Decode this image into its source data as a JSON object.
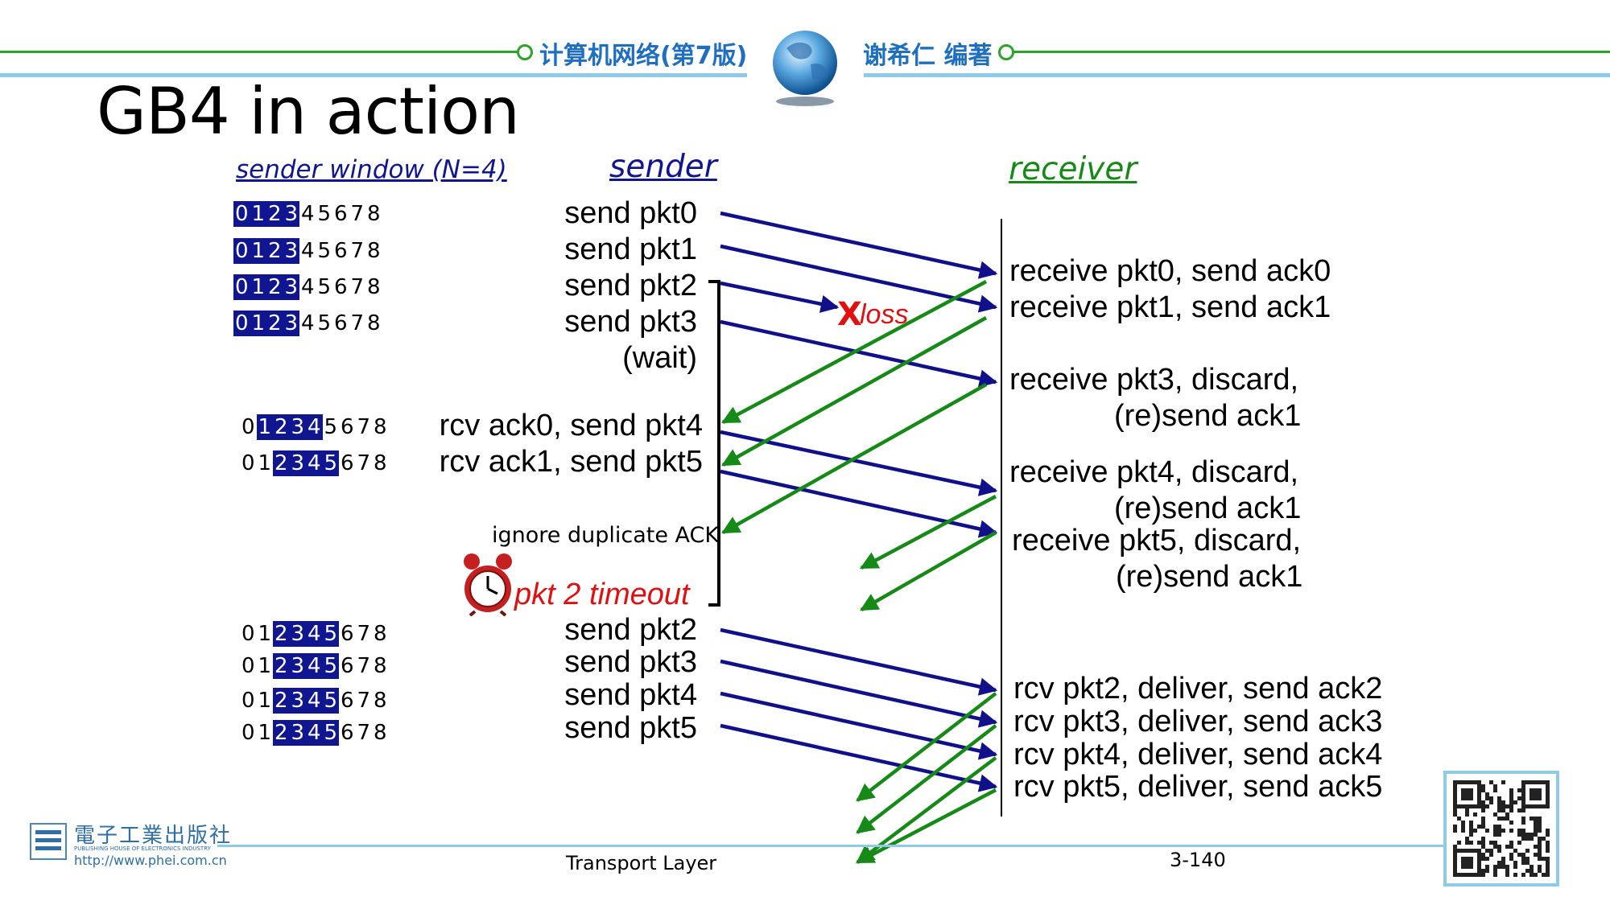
{
  "header": {
    "book_title": "计算机网络(第7版)",
    "author": "谢希仁 编著"
  },
  "slide": {
    "title": "GB4 in action"
  },
  "labels": {
    "sender_window": "sender window (N=4)",
    "sender": "sender",
    "receiver": "receiver",
    "loss_mark": "X",
    "loss": "loss",
    "ignore_dup": "ignore duplicate ACK",
    "timeout": "pkt 2 timeout"
  },
  "windows": [
    {
      "seq": [
        "0",
        "1",
        "2",
        "3",
        "4",
        "5",
        "6",
        "7",
        "8"
      ],
      "start": 0
    },
    {
      "seq": [
        "0",
        "1",
        "2",
        "3",
        "4",
        "5",
        "6",
        "7",
        "8"
      ],
      "start": 0
    },
    {
      "seq": [
        "0",
        "1",
        "2",
        "3",
        "4",
        "5",
        "6",
        "7",
        "8"
      ],
      "start": 0
    },
    {
      "seq": [
        "0",
        "1",
        "2",
        "3",
        "4",
        "5",
        "6",
        "7",
        "8"
      ],
      "start": 0
    },
    {
      "seq": [
        "0",
        "1",
        "2",
        "3",
        "4",
        "5",
        "6",
        "7",
        "8"
      ],
      "start": 1
    },
    {
      "seq": [
        "0",
        "1",
        "2",
        "3",
        "4",
        "5",
        "6",
        "7",
        "8"
      ],
      "start": 2
    },
    {
      "seq": [
        "0",
        "1",
        "2",
        "3",
        "4",
        "5",
        "6",
        "7",
        "8"
      ],
      "start": 2
    },
    {
      "seq": [
        "0",
        "1",
        "2",
        "3",
        "4",
        "5",
        "6",
        "7",
        "8"
      ],
      "start": 2
    },
    {
      "seq": [
        "0",
        "1",
        "2",
        "3",
        "4",
        "5",
        "6",
        "7",
        "8"
      ],
      "start": 2
    },
    {
      "seq": [
        "0",
        "1",
        "2",
        "3",
        "4",
        "5",
        "6",
        "7",
        "8"
      ],
      "start": 2
    }
  ],
  "sender_events": [
    "send  pkt0",
    "send  pkt1",
    "send  pkt2",
    "send  pkt3",
    "(wait)",
    "rcv ack0, send pkt4",
    "rcv ack1, send pkt5",
    "send  pkt2",
    "send  pkt3",
    "send  pkt4",
    "send  pkt5"
  ],
  "receiver_events": [
    "receive pkt0, send ack0",
    "receive pkt1, send ack1",
    "receive pkt3, discard,",
    "(re)send ack1",
    "receive pkt4, discard,",
    "(re)send ack1",
    "receive pkt5, discard,",
    "(re)send ack1",
    "rcv pkt2, deliver, send ack2",
    "rcv pkt3, deliver, send ack3",
    "rcv pkt4, deliver, send ack4",
    "rcv pkt5, deliver, send ack5"
  ],
  "footer": {
    "publisher_cn": "電子工業出版社",
    "publisher_en": "PUBLISHING HOUSE OF ELECTRONICS INDUSTRY",
    "url": "http://www.phei.com.cn",
    "section": "Transport Layer",
    "page": "3-140"
  },
  "colors": {
    "data_arrow": "#10108a",
    "ack_arrow": "#168a16",
    "window_fill": "#101590",
    "loss": "#e01010",
    "header_text": "#1f6fc0"
  }
}
